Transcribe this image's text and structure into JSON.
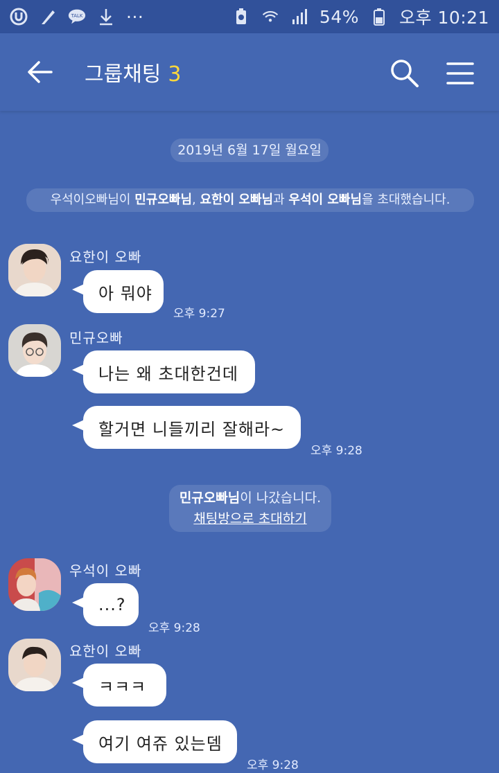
{
  "status_bar": {
    "icons_left": [
      "u-plus-icon",
      "quill-icon",
      "kakaotalk-icon",
      "download-icon",
      "more-dots-icon"
    ],
    "kakao_label": "TALK",
    "more_dots": "···",
    "battery": "54%",
    "time": "오후 10:21"
  },
  "header": {
    "title": "그룹채팅",
    "member_count": "3"
  },
  "messages": {
    "date_divider": "2019년 6월 17일 월요일",
    "invite_notice": {
      "part1": "우석이오빠님이",
      "part2": "민규오빠님",
      "part3": ", ",
      "part4": "요한이 오빠님",
      "part5": "과 ",
      "part6": "우석이 오빠님",
      "part7": "을 초대했습니다."
    },
    "group1": {
      "sender": "요한이 오빠",
      "bubble1": "아 뭐야",
      "time": "오후 9:27"
    },
    "group2": {
      "sender": "민규오빠",
      "bubble1": "나는 왜 초대한건데",
      "bubble2": "할거면 니들끼리 잘해라~",
      "time": "오후 9:28"
    },
    "leave_notice": {
      "name": "민규오빠님",
      "text": "이 나갔습니다.",
      "link": "채팅방으로 초대하기"
    },
    "group3": {
      "sender": "우석이 오빠",
      "bubble1": "...?",
      "time": "오후 9:28"
    },
    "group4": {
      "sender": "요한이 오빠",
      "bubble1": "ㅋㅋㅋ",
      "bubble2": "여기 여쥬 있는뎀",
      "time": "오후 9:28"
    }
  },
  "colors": {
    "background": "#4467b2",
    "status_bar": "#31519a",
    "member_count": "#ffd83b",
    "bubble": "#ffffff"
  }
}
